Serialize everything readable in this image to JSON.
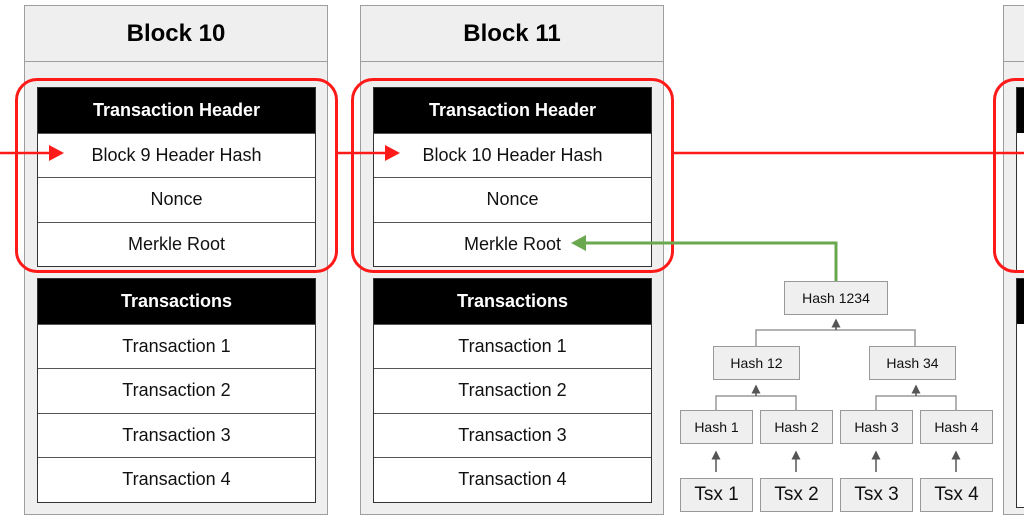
{
  "blocks": [
    {
      "title": "Block 10",
      "header_title": "Transaction Header",
      "header_rows": [
        "Block 9 Header Hash",
        "Nonce",
        "Merkle Root"
      ],
      "tx_title": "Transactions",
      "tx_rows": [
        "Transaction 1",
        "Transaction 2",
        "Transaction 3",
        "Transaction 4"
      ]
    },
    {
      "title": "Block 11",
      "header_title": "Transaction Header",
      "header_rows": [
        "Block 10 Header Hash",
        "Nonce",
        "Merkle Root"
      ],
      "tx_title": "Transactions",
      "tx_rows": [
        "Transaction 1",
        "Transaction 2",
        "Transaction 3",
        "Transaction 4"
      ]
    }
  ],
  "merkle": {
    "root": "Hash 1234",
    "level1": [
      "Hash 12",
      "Hash 34"
    ],
    "leaves": [
      "Hash 1",
      "Hash 2",
      "Hash 3",
      "Hash 4"
    ],
    "tsx": [
      "Tsx 1",
      "Tsx 2",
      "Tsx 3",
      "Tsx 4"
    ]
  },
  "colors": {
    "chain_link": "#ff1a1a",
    "merkle_link": "#6aa84f",
    "header_fill": "#000000",
    "block_fill": "#efefef"
  }
}
